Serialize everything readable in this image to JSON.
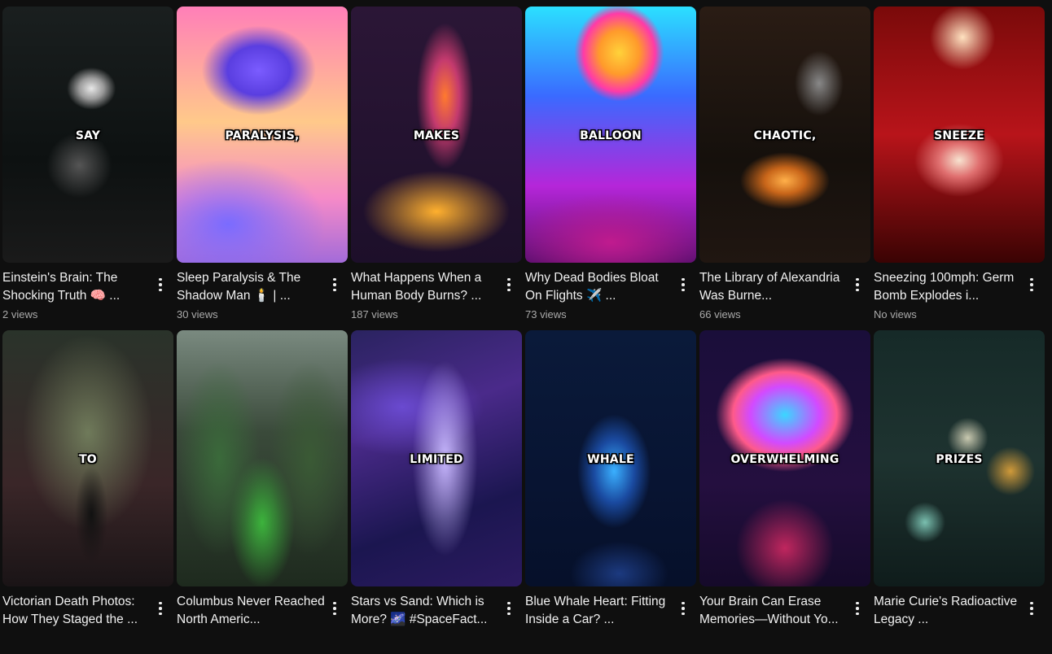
{
  "videos": [
    {
      "title": "Einstein's Brain: The Shocking Truth 🧠 ...",
      "views": "2 views",
      "caption": "SAY",
      "thumb": "t1"
    },
    {
      "title": "Sleep Paralysis & The Shadow Man 🕯️ | ...",
      "views": "30 views",
      "caption": "PARALYSIS,",
      "thumb": "t2"
    },
    {
      "title": "What Happens When a Human Body Burns? ...",
      "views": "187 views",
      "caption": "MAKES",
      "thumb": "t3"
    },
    {
      "title": "Why Dead Bodies Bloat On Flights ✈️ ...",
      "views": "73 views",
      "caption": "BALLOON",
      "thumb": "t4"
    },
    {
      "title": "The Library of Alexandria Was Burne...",
      "views": "66 views",
      "caption": "CHAOTIC,",
      "thumb": "t5"
    },
    {
      "title": "Sneezing 100mph: Germ Bomb Explodes i...",
      "views": "No views",
      "caption": "SNEEZE",
      "thumb": "t6"
    },
    {
      "title": "Victorian Death Photos: How They Staged the ...",
      "views": "",
      "caption": "TO",
      "thumb": "t7"
    },
    {
      "title": "Columbus Never Reached North Americ...",
      "views": "",
      "caption": "",
      "thumb": "t8"
    },
    {
      "title": "Stars vs Sand: Which is More? 🌌 #SpaceFact...",
      "views": "",
      "caption": "LIMITED",
      "thumb": "t9"
    },
    {
      "title": "Blue Whale Heart: Fitting Inside a Car? ...",
      "views": "",
      "caption": "WHALE",
      "thumb": "t10"
    },
    {
      "title": "Your Brain Can Erase Memories—Without Yo...",
      "views": "",
      "caption": "OVERWHELMING",
      "thumb": "t11"
    },
    {
      "title": "Marie Curie's Radioactive Legacy ...",
      "views": "",
      "caption": "PRIZES",
      "thumb": "t12"
    }
  ]
}
